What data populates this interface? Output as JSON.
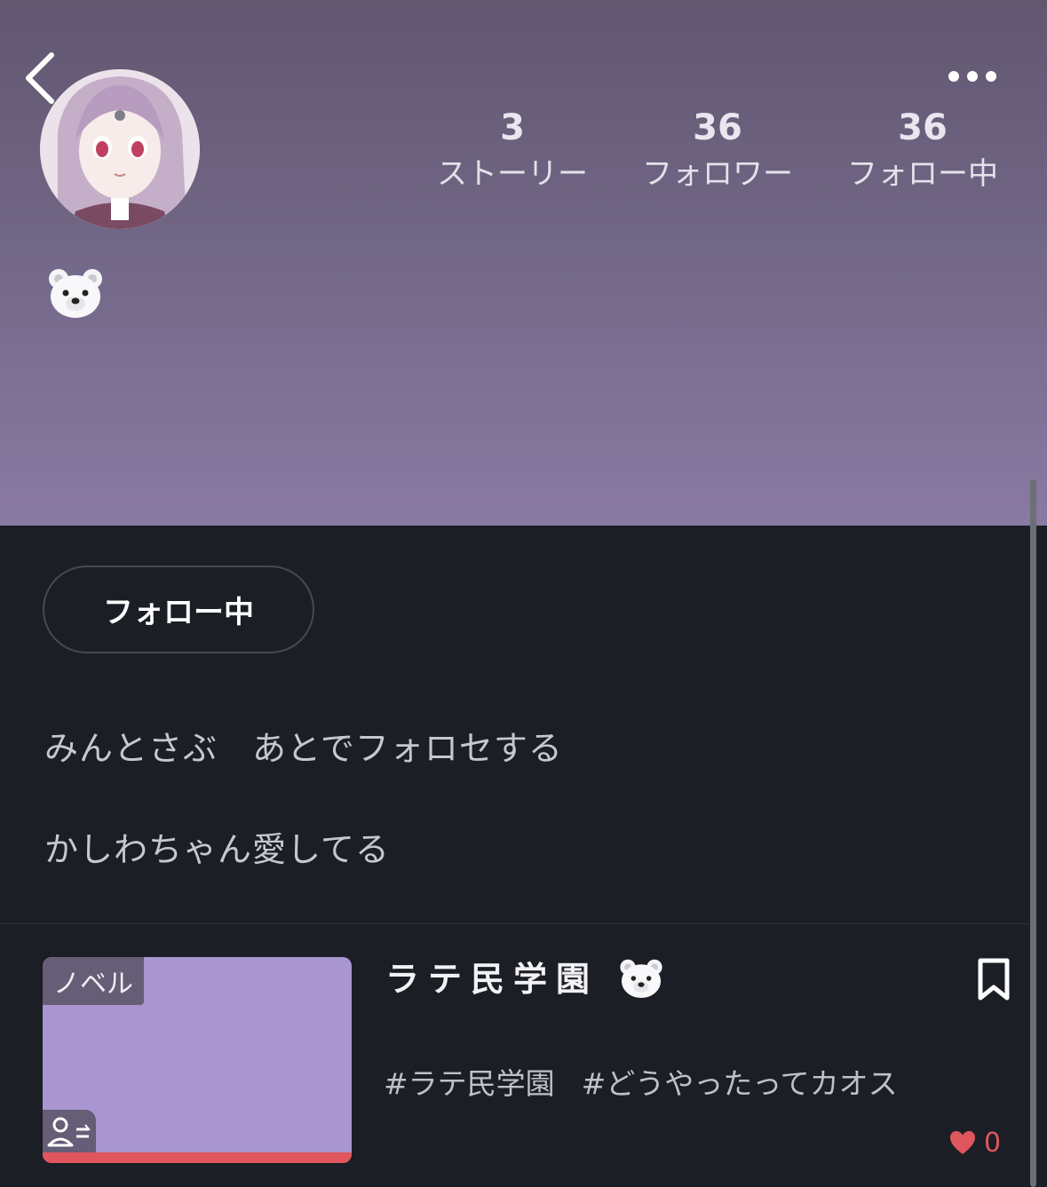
{
  "header": {
    "stats": [
      {
        "value": "3",
        "label": "ストーリー"
      },
      {
        "value": "36",
        "label": "フォロワー"
      },
      {
        "value": "36",
        "label": "フォロー中"
      }
    ],
    "badge_icon": "polar-bear-emoji"
  },
  "profile": {
    "follow_button_label": "フォロー中",
    "bio_lines": [
      "みんとさぶ　あとでフォロセする",
      "かしわちゃん愛してる"
    ]
  },
  "story": {
    "type_tag": "ノベル",
    "title": "ラテ民学園",
    "title_icon": "polar-bear-emoji",
    "tags": [
      "#ラテ民学園",
      "#どうやったってカオス"
    ],
    "likes": "0"
  },
  "colors": {
    "accent_red": "#e0565d",
    "header_top": "#625770",
    "header_bottom": "#8a7aa3",
    "background": "#1b1e25",
    "thumbnail": "#a996d1"
  }
}
